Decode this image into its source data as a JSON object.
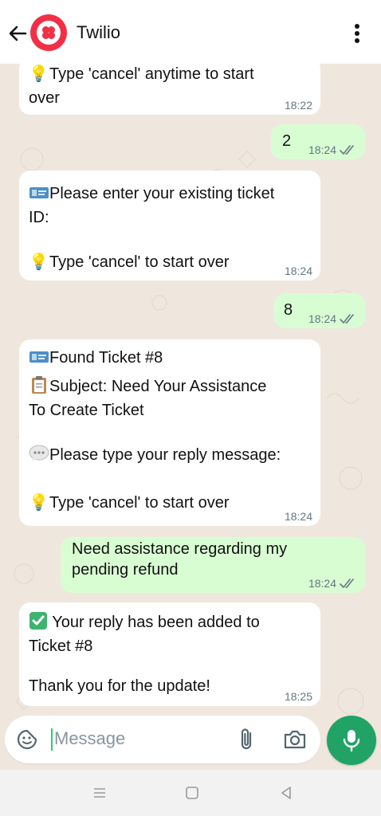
{
  "header": {
    "contact_name": "Twilio"
  },
  "messages": [
    {
      "dir": "in",
      "lines": [
        "💡 Type 'cancel' anytime to start",
        "over"
      ],
      "time": "18:22"
    },
    {
      "dir": "out",
      "text": "2",
      "time": "18:24"
    },
    {
      "dir": "in",
      "lines": [
        "Please enter your existing ticket",
        "ID:",
        "",
        "Type 'cancel' to start over"
      ],
      "time": "18:24"
    },
    {
      "dir": "out",
      "text": "8",
      "time": "18:24"
    },
    {
      "dir": "in",
      "lines": [
        "Found Ticket #8",
        "Subject: Need Your Assistance",
        "To Create Ticket",
        "",
        "Please type your reply message:",
        "",
        "Type 'cancel' to start over"
      ],
      "time": "18:24"
    },
    {
      "dir": "out",
      "lines": [
        "Need assistance regarding my",
        "pending refund"
      ],
      "time": "18:24"
    },
    {
      "dir": "in",
      "lines": [
        "Your reply has been added to",
        "Ticket #8",
        "",
        "Thank you for the update!"
      ],
      "time": "18:25"
    }
  ],
  "composer": {
    "placeholder": "Message"
  },
  "icons": {
    "back": "arrow-left-icon",
    "menu": "kebab-menu-icon",
    "sticker": "sticker-icon",
    "attach": "paperclip-icon",
    "camera": "camera-icon",
    "mic": "microphone-icon",
    "read": "double-check-icon",
    "bulb": "light-bulb-icon",
    "ticket": "ticket-icon",
    "clipboard": "clipboard-icon",
    "speech": "speech-bubble-icon",
    "check": "check-mark-button-icon"
  },
  "colors": {
    "accent": "#21a366",
    "incoming": "#ffffff",
    "outgoing": "#d9fdd3",
    "background": "#efe7de",
    "read_ticks": "#53bdeb"
  }
}
